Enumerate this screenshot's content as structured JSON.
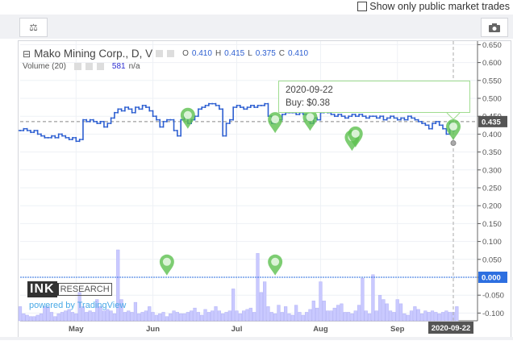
{
  "top": {
    "checkbox_label": "Show only public market trades",
    "checked": false
  },
  "toolbar": {
    "scales_icon": "scales-icon",
    "camera_icon": "camera-icon"
  },
  "legend": {
    "symbol": "Mako Mining Corp., D, V",
    "o_label": "O",
    "o": "0.410",
    "h_label": "H",
    "h": "0.415",
    "l_label": "L",
    "l": "0.375",
    "c_label": "C",
    "c": "0.410",
    "volume_label": "Volume (20)",
    "volume_value": "581",
    "volume_extra": "n/a"
  },
  "tooltip": {
    "date": "2020-09-22",
    "text": "Buy: $0.38"
  },
  "branding": {
    "logo_ink": "INK",
    "logo_research": "RESEARCH",
    "powered": "powered by TradingView"
  },
  "colors": {
    "price": "#2d5fd1",
    "volume": "#c9c9ff",
    "marker": "#5cc14f",
    "zero_line": "#2d6fe0"
  },
  "chart_data": {
    "type": "line",
    "title": "Mako Mining Corp., D, V",
    "y_ticks": [
      "0.650",
      "0.600",
      "0.550",
      "0.500",
      "0.450",
      "0.400",
      "0.350",
      "0.300",
      "0.250",
      "0.200",
      "0.150",
      "0.100",
      "0.050",
      "0.000",
      "-0.050",
      "-0.100"
    ],
    "ylim": [
      -0.12,
      0.66
    ],
    "x_ticks": [
      "May",
      "Jun",
      "Jul",
      "Aug",
      "Sep"
    ],
    "x_tick_bar_index": [
      16,
      38,
      62,
      86,
      108
    ],
    "crosshair_label": "2020-09-22",
    "last_price_label": "0.435",
    "zero_label": "0.000",
    "last_price": 0.435,
    "closes": [
      0.41,
      0.415,
      0.41,
      0.405,
      0.41,
      0.4,
      0.395,
      0.39,
      0.39,
      0.395,
      0.39,
      0.4,
      0.395,
      0.39,
      0.385,
      0.39,
      0.38,
      0.385,
      0.44,
      0.435,
      0.44,
      0.435,
      0.43,
      0.435,
      0.42,
      0.43,
      0.445,
      0.46,
      0.47,
      0.465,
      0.475,
      0.47,
      0.46,
      0.475,
      0.47,
      0.48,
      0.475,
      0.465,
      0.45,
      0.44,
      0.42,
      0.435,
      0.44,
      0.44,
      0.41,
      0.395,
      0.44,
      0.45,
      0.43,
      0.44,
      0.45,
      0.47,
      0.475,
      0.48,
      0.485,
      0.485,
      0.48,
      0.47,
      0.395,
      0.43,
      0.44,
      0.475,
      0.48,
      0.475,
      0.47,
      0.475,
      0.48,
      0.475,
      0.48,
      0.48,
      0.485,
      0.45,
      0.43,
      0.44,
      0.44,
      0.455,
      0.46,
      0.46,
      0.46,
      0.455,
      0.46,
      0.455,
      0.44,
      0.43,
      0.445,
      0.44,
      0.46,
      0.465,
      0.46,
      0.455,
      0.45,
      0.455,
      0.45,
      0.445,
      0.45,
      0.455,
      0.45,
      0.455,
      0.45,
      0.445,
      0.45,
      0.45,
      0.445,
      0.45,
      0.44,
      0.445,
      0.45,
      0.445,
      0.44,
      0.445,
      0.44,
      0.45,
      0.445,
      0.44,
      0.435,
      0.43,
      0.425,
      0.415,
      0.43,
      0.435,
      0.425,
      0.415,
      0.4,
      0.43,
      0.41
    ],
    "volumes": [
      20,
      10,
      8,
      6,
      6,
      8,
      10,
      20,
      20,
      12,
      6,
      10,
      12,
      14,
      16,
      12,
      10,
      40,
      20,
      12,
      14,
      12,
      30,
      20,
      14,
      16,
      14,
      10,
      100,
      30,
      12,
      14,
      12,
      26,
      10,
      12,
      14,
      20,
      12,
      8,
      10,
      12,
      6,
      10,
      14,
      12,
      10,
      10,
      12,
      14,
      18,
      12,
      8,
      16,
      12,
      14,
      20,
      14,
      10,
      12,
      14,
      45,
      14,
      10,
      14,
      16,
      18,
      12,
      95,
      40,
      55,
      20,
      12,
      10,
      22,
      12,
      20,
      10,
      8,
      22,
      12,
      8,
      12,
      16,
      28,
      18,
      55,
      28,
      14,
      14,
      18,
      22,
      24,
      12,
      12,
      10,
      14,
      22,
      60,
      14,
      10,
      65,
      14,
      36,
      30,
      24,
      14,
      12,
      30,
      24,
      10,
      8,
      14,
      20,
      16,
      10,
      14,
      12,
      14,
      12,
      10,
      12,
      14,
      12,
      12,
      20
    ],
    "trade_markers": [
      {
        "bar": 48,
        "price": 0.442,
        "pane": "price"
      },
      {
        "bar": 73,
        "price": 0.43,
        "pane": "price"
      },
      {
        "bar": 83,
        "price": 0.436,
        "pane": "price"
      },
      {
        "bar": 95,
        "price": 0.38,
        "pane": "price"
      },
      {
        "bar": 96,
        "price": 0.39,
        "pane": "price"
      },
      {
        "bar": 124,
        "price": 0.41,
        "pane": "price",
        "selected": true
      },
      {
        "bar": 42,
        "price": 0.032,
        "pane": "volume"
      },
      {
        "bar": 73,
        "price": 0.032,
        "pane": "volume"
      }
    ]
  }
}
